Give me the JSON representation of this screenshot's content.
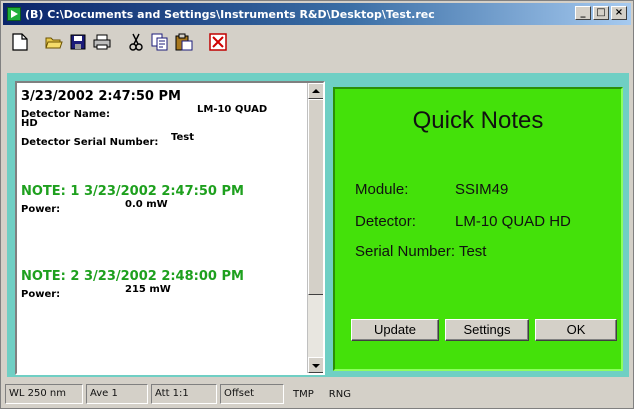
{
  "window": {
    "title": "(B) C:\\Documents and Settings\\Instruments R&D\\Desktop\\Test.rec",
    "controls": [
      "_",
      "□",
      "×"
    ]
  },
  "toolbar": {
    "buttons": [
      {
        "name": "new-icon"
      },
      {
        "name": "open-folder-icon"
      },
      {
        "name": "save-icon"
      },
      {
        "name": "print-icon"
      },
      {
        "name": "cut-icon"
      },
      {
        "name": "copy-icon"
      },
      {
        "name": "paste-icon"
      },
      {
        "name": "delete-icon"
      }
    ]
  },
  "notes_list": {
    "header_timestamp": "3/23/2002  2:47:50 PM",
    "detector_name_label": "Detector Name:",
    "detector_name_value": "LM-10 QUAD",
    "detector_name_wrap": "HD",
    "serial_label": "Detector Serial Number:",
    "serial_value": "Test",
    "notes": [
      {
        "heading": "NOTE: 1  3/23/2002  2:47:50 PM",
        "power_label": "Power:",
        "power_value": "0.0 mW"
      },
      {
        "heading": "NOTE: 2  3/23/2002  2:48:00 PM",
        "power_label": "Power:",
        "power_value": "215 mW"
      }
    ]
  },
  "quick_notes": {
    "title": "Quick Notes",
    "module_label": "Module:",
    "module_value": "SSIM49",
    "detector_label": "Detector:",
    "detector_value": "LM-10 QUAD HD",
    "serial_label": "Serial Number:",
    "serial_value": "Test",
    "update_label": "Update",
    "settings_label": "Settings",
    "ok_label": "OK"
  },
  "status": {
    "wavelength": "WL 250 nm",
    "average": "Ave 1",
    "attenuation": "Att 1:1",
    "offset": "Offset",
    "tmp": "TMP",
    "rng": "RNG"
  },
  "colors": {
    "client_bg": "#6fcfc4",
    "quick_panel_bg": "#44e10a",
    "note_heading": "#1ea01e"
  }
}
